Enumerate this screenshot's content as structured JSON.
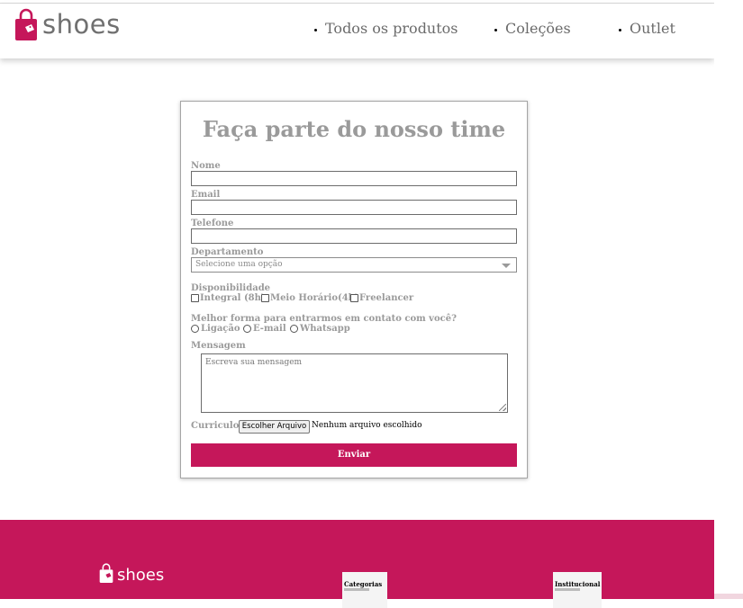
{
  "brand": {
    "name": "shoes",
    "color": "#c5175a"
  },
  "nav": {
    "items": [
      {
        "label": "Todos os produtos"
      },
      {
        "label": "Coleções"
      },
      {
        "label": "Outlet"
      }
    ]
  },
  "form": {
    "title": "Faça parte do nosso time",
    "fields": {
      "nome": {
        "label": "Nome",
        "value": ""
      },
      "email": {
        "label": "Email",
        "value": ""
      },
      "telefone": {
        "label": "Telefone",
        "value": ""
      }
    },
    "departamento": {
      "label": "Departamento",
      "selected": "Selecione uma opção"
    },
    "disponibilidade": {
      "label": "Disponibilidade",
      "options": [
        "Integral (8h)",
        "Meio Horário(4h)",
        "Freelancer"
      ]
    },
    "contato": {
      "label": "Melhor forma para entrarmos em contato com você?",
      "options": [
        "Ligação",
        "E-mail",
        "Whatsapp"
      ]
    },
    "mensagem": {
      "label": "Mensagem",
      "placeholder": "Escreva sua mensagem"
    },
    "curriculo": {
      "label": "Curriculo",
      "button": "Escolher Arquivo",
      "status": "Nenhum arquivo escolhido"
    },
    "submit_label": "Enviar"
  },
  "footer": {
    "logo": "shoes",
    "columns": [
      {
        "title": "Categorias"
      },
      {
        "title": "Institucional"
      }
    ]
  }
}
